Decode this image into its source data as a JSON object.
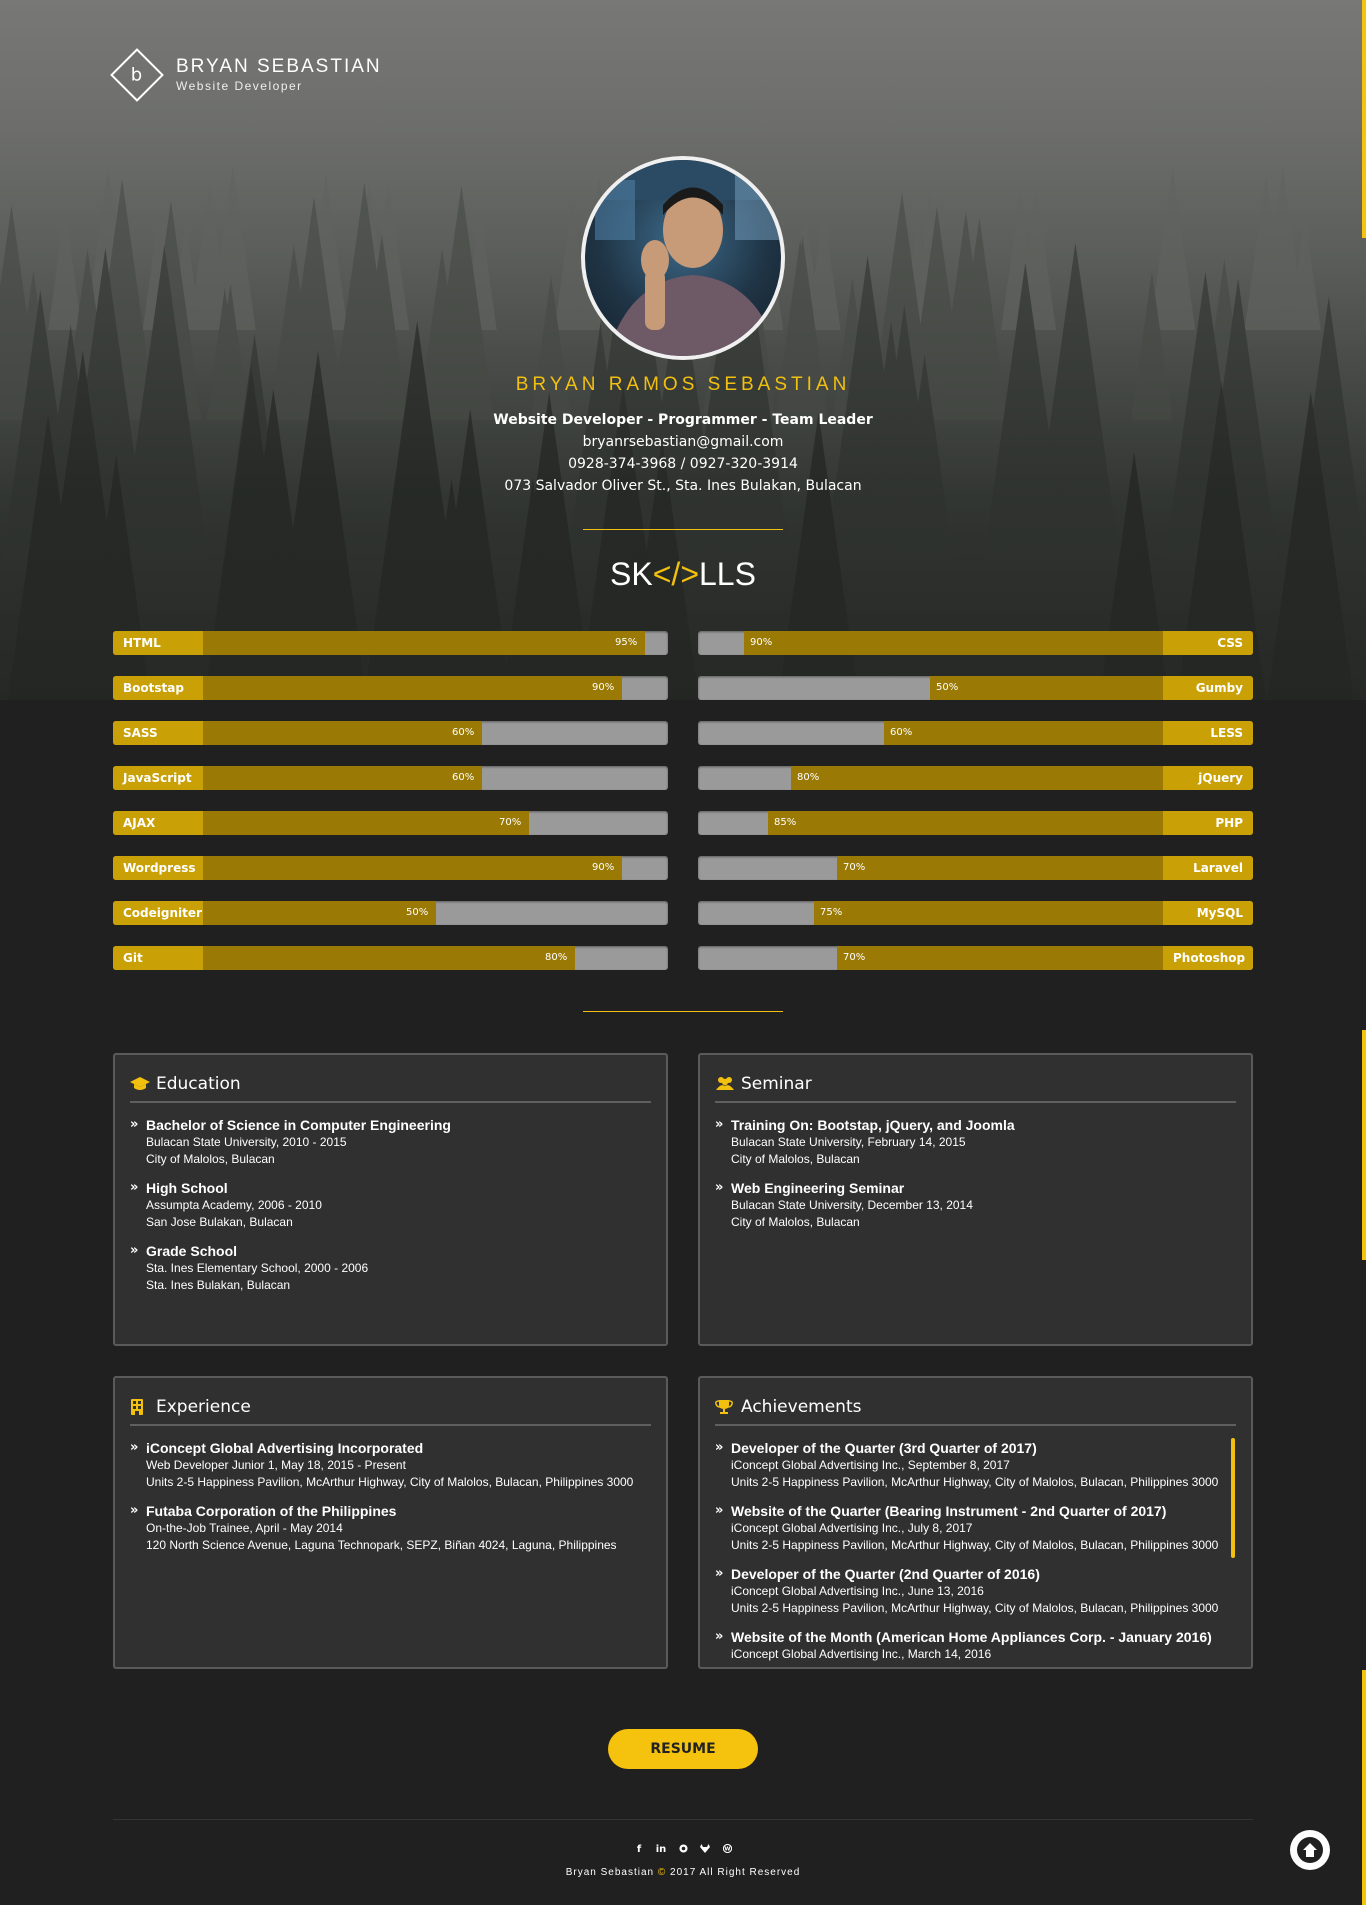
{
  "logo": {
    "letter": "b",
    "name": "BRYAN SEBASTIAN",
    "role": "Website Developer"
  },
  "profile": {
    "full_name": "BRYAN RAMOS SEBASTIAN",
    "title": "Website Developer - Programmer - Team Leader",
    "email": "bryanrsebastian@gmail.com",
    "phone": "0928-374-3968 / 0927-320-3914",
    "address": "073 Salvador Oliver St., Sta. Ines Bulakan, Bulacan"
  },
  "skills": {
    "title_pre": "SK",
    "title_code": "</>",
    "title_post": "LLS",
    "left": [
      {
        "name": "HTML",
        "value": 95,
        "label": "95%"
      },
      {
        "name": "Bootstap",
        "value": 90,
        "label": "90%"
      },
      {
        "name": "SASS",
        "value": 60,
        "label": "60%"
      },
      {
        "name": "JavaScript",
        "value": 60,
        "label": "60%"
      },
      {
        "name": "AJAX",
        "value": 70,
        "label": "70%"
      },
      {
        "name": "Wordpress",
        "value": 90,
        "label": "90%"
      },
      {
        "name": "Codeigniter",
        "value": 50,
        "label": "50%"
      },
      {
        "name": "Git",
        "value": 80,
        "label": "80%"
      }
    ],
    "right": [
      {
        "name": "CSS",
        "value": 90,
        "label": "90%"
      },
      {
        "name": "Gumby",
        "value": 50,
        "label": "50%"
      },
      {
        "name": "LESS",
        "value": 60,
        "label": "60%"
      },
      {
        "name": "jQuery",
        "value": 80,
        "label": "80%"
      },
      {
        "name": "PHP",
        "value": 85,
        "label": "85%"
      },
      {
        "name": "Laravel",
        "value": 70,
        "label": "70%"
      },
      {
        "name": "MySQL",
        "value": 75,
        "label": "75%"
      },
      {
        "name": "Photoshop",
        "value": 70,
        "label": "70%"
      }
    ]
  },
  "education": {
    "title": "Education",
    "icon": "graduation-cap-icon",
    "items": [
      {
        "head": "Bachelor of Science in Computer Engineering",
        "line1": "Bulacan State University, 2010 - 2015",
        "line2": "City of Malolos, Bulacan"
      },
      {
        "head": "High School",
        "line1": "Assumpta Academy, 2006 - 2010",
        "line2": "San Jose Bulakan, Bulacan"
      },
      {
        "head": "Grade School",
        "line1": "Sta. Ines Elementary School, 2000 - 2006",
        "line2": "Sta. Ines Bulakan, Bulacan"
      }
    ]
  },
  "seminar": {
    "title": "Seminar",
    "icon": "users-icon",
    "items": [
      {
        "head": "Training On: Bootstap, jQuery, and Joomla",
        "line1": "Bulacan State University, February 14, 2015",
        "line2": "City of Malolos, Bulacan"
      },
      {
        "head": "Web Engineering Seminar",
        "line1": "Bulacan State University, December 13, 2014",
        "line2": "City of Malolos, Bulacan"
      }
    ]
  },
  "experience": {
    "title": "Experience",
    "icon": "building-icon",
    "items": [
      {
        "head": "iConcept Global Advertising Incorporated",
        "line1": "Web Developer Junior 1, May 18, 2015 - Present",
        "line2": "Units 2-5 Happiness Pavilion, McArthur Highway, City of Malolos, Bulacan, Philippines 3000"
      },
      {
        "head": "Futaba Corporation of the Philippines",
        "line1": "On-the-Job Trainee, April - May 2014",
        "line2": "120 North Science Avenue, Laguna Technopark, SEPZ, Biñan 4024, Laguna, Philippines"
      }
    ]
  },
  "achievements": {
    "title": "Achievements",
    "icon": "trophy-icon",
    "items": [
      {
        "head": "Developer of the Quarter (3rd Quarter of 2017)",
        "line1": "iConcept Global Advertising Inc., September 8, 2017",
        "line2": "Units 2-5 Happiness Pavilion, McArthur Highway, City of Malolos, Bulacan, Philippines 3000"
      },
      {
        "head": "Website of the Quarter (Bearing Instrument - 2nd Quarter of 2017)",
        "line1": "iConcept Global Advertising Inc., July 8, 2017",
        "line2": "Units 2-5 Happiness Pavilion, McArthur Highway, City of Malolos, Bulacan, Philippines 3000"
      },
      {
        "head": "Developer of the Quarter (2nd Quarter of 2016)",
        "line1": "iConcept Global Advertising Inc., June 13, 2016",
        "line2": "Units 2-5 Happiness Pavilion, McArthur Highway, City of Malolos, Bulacan, Philippines 3000"
      },
      {
        "head": "Website of the Month (American Home Appliances Corp. - January 2016)",
        "line1": "iConcept Global Advertising Inc., March 14, 2016",
        "line2": ""
      }
    ]
  },
  "resume_button": "RESUME",
  "footer": {
    "socials": [
      "facebook-icon",
      "linkedin-icon",
      "github-icon",
      "gitlab-icon",
      "wordpress-icon"
    ],
    "owner": "Bryan Sebastian",
    "copyright_symbol": "©",
    "rights": "2017 All Right Reserved"
  },
  "colors": {
    "accent": "#f2c00f",
    "bar_fill": "#9a7a05",
    "bar_label": "#c9a106",
    "background": "#202020"
  }
}
